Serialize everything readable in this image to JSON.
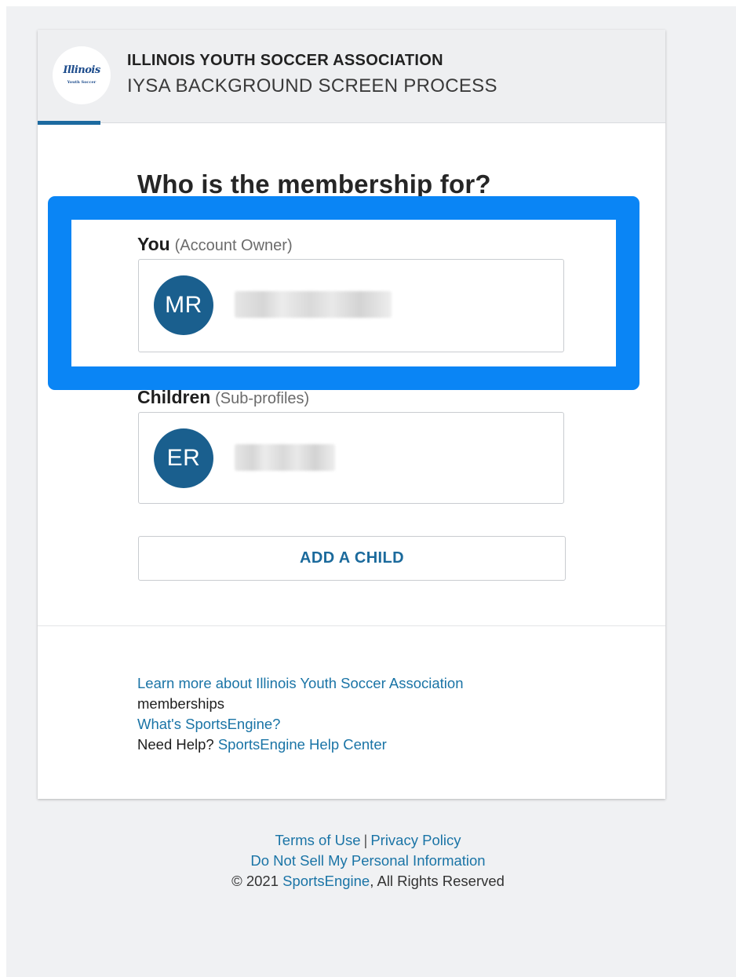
{
  "header": {
    "org_name": "ILLINOIS YOUTH SOCCER ASSOCIATION",
    "process_name": "IYSA BACKGROUND SCREEN PROCESS",
    "logo_text": "Illinois",
    "logo_subtext": "Youth Soccer"
  },
  "main": {
    "heading": "Who is the membership for?",
    "you_section": {
      "label": "You",
      "sublabel": "(Account Owner)",
      "profile": {
        "initials": "MR",
        "name": ""
      }
    },
    "children_section": {
      "label": "Children",
      "sublabel": "(Sub-profiles)",
      "profiles": [
        {
          "initials": "ER",
          "name": ""
        }
      ]
    },
    "add_child_label": "ADD A CHILD"
  },
  "info": {
    "learn_more_link": "Learn more about Illinois Youth Soccer Association",
    "learn_more_suffix": "memberships",
    "whats_link": "What's SportsEngine?",
    "help_prefix": "Need Help?",
    "help_link": "SportsEngine Help Center"
  },
  "footer": {
    "terms": "Terms of Use",
    "separator": "|",
    "privacy": "Privacy Policy",
    "do_not_sell": "Do Not Sell My Personal Information",
    "copyright_prefix": "© 2021",
    "brand_link": "SportsEngine",
    "copyright_suffix": ", All Rights Reserved"
  },
  "colors": {
    "highlight": "#0a85f5",
    "avatar": "#1a5f8e",
    "link": "#1a74a6",
    "progress": "#1c6aa0"
  }
}
